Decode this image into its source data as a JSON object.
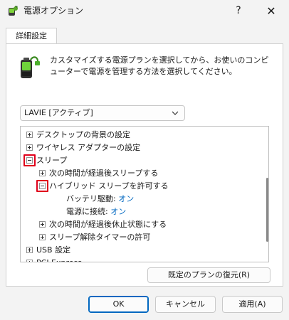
{
  "window": {
    "title": "電源オプション",
    "help_label": "?",
    "close_label": "✕"
  },
  "tabs": [
    {
      "label": "詳細設定"
    }
  ],
  "description": "カスタマイズする電源プランを選択してから、お使いのコンピューターで電源を管理する方法を選択してください。",
  "plan_select": {
    "value": "LAVIE [アクティブ]"
  },
  "tree": {
    "items": [
      {
        "label": "デスクトップの背景の設定",
        "expander": "+"
      },
      {
        "label": "ワイヤレス アダプターの設定",
        "expander": "+"
      },
      {
        "label": "スリープ",
        "expander": "−"
      },
      {
        "label": "次の時間が経過後スリープする",
        "expander": "+"
      },
      {
        "label": "ハイブリッド スリープを許可する",
        "expander": "−"
      },
      {
        "label": "バッテリ駆動:",
        "value": "オン"
      },
      {
        "label": "電源に接続:",
        "value": "オン"
      },
      {
        "label": "次の時間が経過後休止状態にする",
        "expander": "+"
      },
      {
        "label": "スリープ解除タイマーの許可",
        "expander": "+"
      },
      {
        "label": "USB 設定",
        "expander": "+"
      },
      {
        "label": "PCI Express",
        "expander": "+"
      }
    ]
  },
  "buttons": {
    "restore_defaults": "既定のプランの復元(R)",
    "ok": "OK",
    "cancel": "キャンセル",
    "apply": "適用(A)"
  },
  "colors": {
    "accent": "#0067c0",
    "highlight": "#e0001b",
    "background": "#f3f3f3"
  },
  "icons": {
    "window": "power-options-icon",
    "description": "battery-plug-icon",
    "dropdown": "chevron-down-icon"
  }
}
